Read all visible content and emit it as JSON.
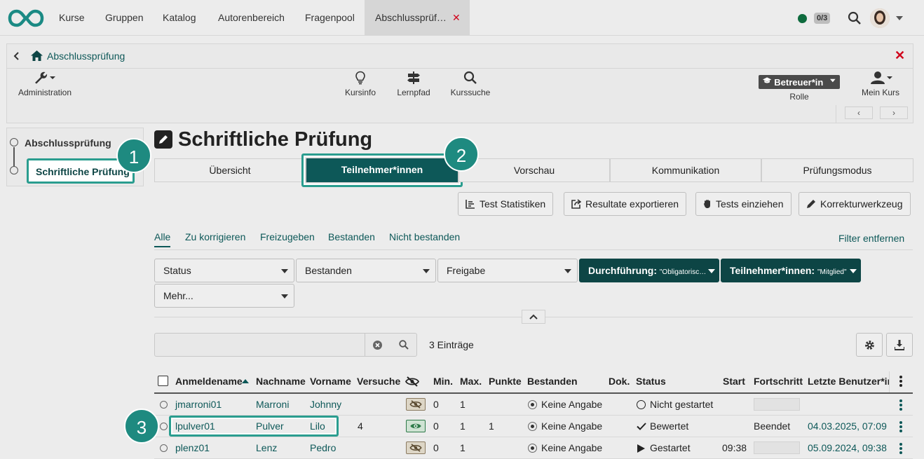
{
  "nav": {
    "items": [
      "Kurse",
      "Gruppen",
      "Katalog",
      "Autorenbereich",
      "Fragenpool"
    ],
    "active_tab": "Abschlussprüf…",
    "close": "✕",
    "counter": "0/3"
  },
  "course": {
    "title": "Abschlussprüfung",
    "close": "✕",
    "tools": {
      "administration": "Administration",
      "kursinfo": "Kursinfo",
      "lernpfad": "Lernpfad",
      "kurssuche": "Kurssuche",
      "role_value": "Betreuer*in",
      "role_label": "Rolle",
      "mein_kurs": "Mein Kurs"
    }
  },
  "sidebar": {
    "root": "Abschlussprüfung",
    "child": "Schriftliche Prüfung"
  },
  "callouts": [
    "1",
    "2",
    "3"
  ],
  "main": {
    "title": "Schriftliche Prüfung",
    "tabs": [
      "Übersicht",
      "Teilnehmer*innen",
      "Vorschau",
      "Kommunikation",
      "Prüfungsmodus"
    ],
    "actions": {
      "stats": "Test Statistiken",
      "export": "Resultate exportieren",
      "collect": "Tests einziehen",
      "correct": "Korrekturwerkzeug"
    },
    "filters": [
      "Alle",
      "Zu korrigieren",
      "Freizugeben",
      "Bestanden",
      "Nicht bestanden"
    ],
    "remove_filter": "Filter entfernen",
    "dropdowns": {
      "status": "Status",
      "bestanden": "Bestanden",
      "freigabe": "Freigabe",
      "durchfuehrung_label": "Durchführung:",
      "durchfuehrung_value": "\"Obligatorisc…",
      "teilnehmer_label": "Teilnehmer*innen:",
      "teilnehmer_value": "\"Mitglied\"",
      "mehr": "Mehr..."
    },
    "entries": "3 Einträge",
    "search_value": ""
  },
  "table": {
    "headers": {
      "login": "Anmeldename",
      "lastname": "Nachname",
      "firstname": "Vorname",
      "attempts": "Versuche",
      "min": "Min.",
      "max": "Max.",
      "points": "Punkte",
      "passed": "Bestanden",
      "doc": "Dok.",
      "status": "Status",
      "start": "Start",
      "progress": "Fortschritt",
      "last_user": "Letzte Benutzer*in"
    },
    "rows": [
      {
        "login": "jmarroni01",
        "lastname": "Marroni",
        "firstname": "Johnny",
        "attempts": "",
        "min": "0",
        "max": "1",
        "points": "",
        "passed": "Keine Angabe",
        "status": "Nicht gestartet",
        "start": "",
        "progress": "",
        "last_user": ""
      },
      {
        "login": "lpulver01",
        "lastname": "Pulver",
        "firstname": "Lilo",
        "attempts": "4",
        "min": "0",
        "max": "1",
        "points": "1",
        "passed": "Keine Angabe",
        "status": "Bewertet",
        "start": "",
        "progress": "Beendet",
        "last_user": "04.03.2025, 07:09"
      },
      {
        "login": "plenz01",
        "lastname": "Lenz",
        "firstname": "Pedro",
        "attempts": "",
        "min": "0",
        "max": "1",
        "points": "",
        "passed": "Keine Angabe",
        "status": "Gestartet",
        "start": "09:38",
        "progress": "",
        "last_user": "05.09.2024, 09:38"
      }
    ]
  },
  "colors": {
    "accent": "#0d5858",
    "callout": "#2a9d8f",
    "close": "#d0021b"
  }
}
